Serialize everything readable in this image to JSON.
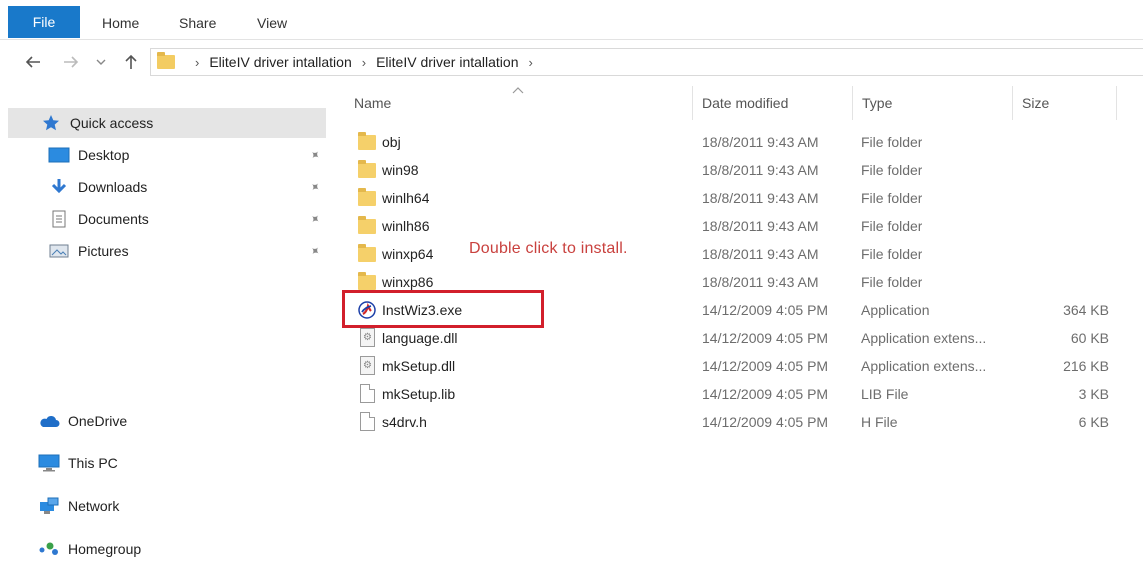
{
  "ribbon": {
    "tabs": [
      "File",
      "Home",
      "Share",
      "View"
    ]
  },
  "nav": {
    "back_icon": "back-arrow-icon",
    "forward_icon": "forward-arrow-icon",
    "recent_icon": "chevron-down-icon",
    "up_icon": "up-arrow-icon",
    "breadcrumbs": [
      "EliteIV driver intallation",
      "EliteIV driver intallation"
    ]
  },
  "sidebar": {
    "items": [
      {
        "label": "Quick access",
        "icon": "star-icon"
      },
      {
        "label": "Desktop",
        "icon": "desktop-icon"
      },
      {
        "label": "Downloads",
        "icon": "download-icon"
      },
      {
        "label": "Documents",
        "icon": "documents-icon"
      },
      {
        "label": "Pictures",
        "icon": "pictures-icon"
      },
      {
        "label": "OneDrive",
        "icon": "cloud-icon"
      },
      {
        "label": "This PC",
        "icon": "computer-icon"
      },
      {
        "label": "Network",
        "icon": "network-icon"
      },
      {
        "label": "Homegroup",
        "icon": "homegroup-icon"
      }
    ]
  },
  "columns": {
    "name": "Name",
    "date": "Date modified",
    "type": "Type",
    "size": "Size"
  },
  "files": [
    {
      "name": "obj",
      "date": "18/8/2011 9:43 AM",
      "type": "File folder",
      "size": "",
      "icon": "folder-icon"
    },
    {
      "name": "win98",
      "date": "18/8/2011 9:43 AM",
      "type": "File folder",
      "size": "",
      "icon": "folder-icon"
    },
    {
      "name": "winlh64",
      "date": "18/8/2011 9:43 AM",
      "type": "File folder",
      "size": "",
      "icon": "folder-icon"
    },
    {
      "name": "winlh86",
      "date": "18/8/2011 9:43 AM",
      "type": "File folder",
      "size": "",
      "icon": "folder-icon"
    },
    {
      "name": "winxp64",
      "date": "18/8/2011 9:43 AM",
      "type": "File folder",
      "size": "",
      "icon": "folder-icon"
    },
    {
      "name": "winxp86",
      "date": "18/8/2011 9:43 AM",
      "type": "File folder",
      "size": "",
      "icon": "folder-icon"
    },
    {
      "name": "InstWiz3.exe",
      "date": "14/12/2009 4:05 PM",
      "type": "Application",
      "size": "364 KB",
      "icon": "installer-app-icon"
    },
    {
      "name": "language.dll",
      "date": "14/12/2009 4:05 PM",
      "type": "Application extens...",
      "size": "60 KB",
      "icon": "dll-file-icon"
    },
    {
      "name": "mkSetup.dll",
      "date": "14/12/2009 4:05 PM",
      "type": "Application extens...",
      "size": "216 KB",
      "icon": "dll-file-icon"
    },
    {
      "name": "mkSetup.lib",
      "date": "14/12/2009 4:05 PM",
      "type": "LIB File",
      "size": "3 KB",
      "icon": "file-icon"
    },
    {
      "name": "s4drv.h",
      "date": "14/12/2009 4:05 PM",
      "type": "H File",
      "size": "6 KB",
      "icon": "file-icon"
    }
  ],
  "annotation": {
    "text": "Double click to install.",
    "color": "#c9413e",
    "box_color": "#d21f2b"
  },
  "colors": {
    "file_tab": "#1979ca",
    "folder": "#f5d06a",
    "sidebar_active": "#e5e5e5"
  }
}
